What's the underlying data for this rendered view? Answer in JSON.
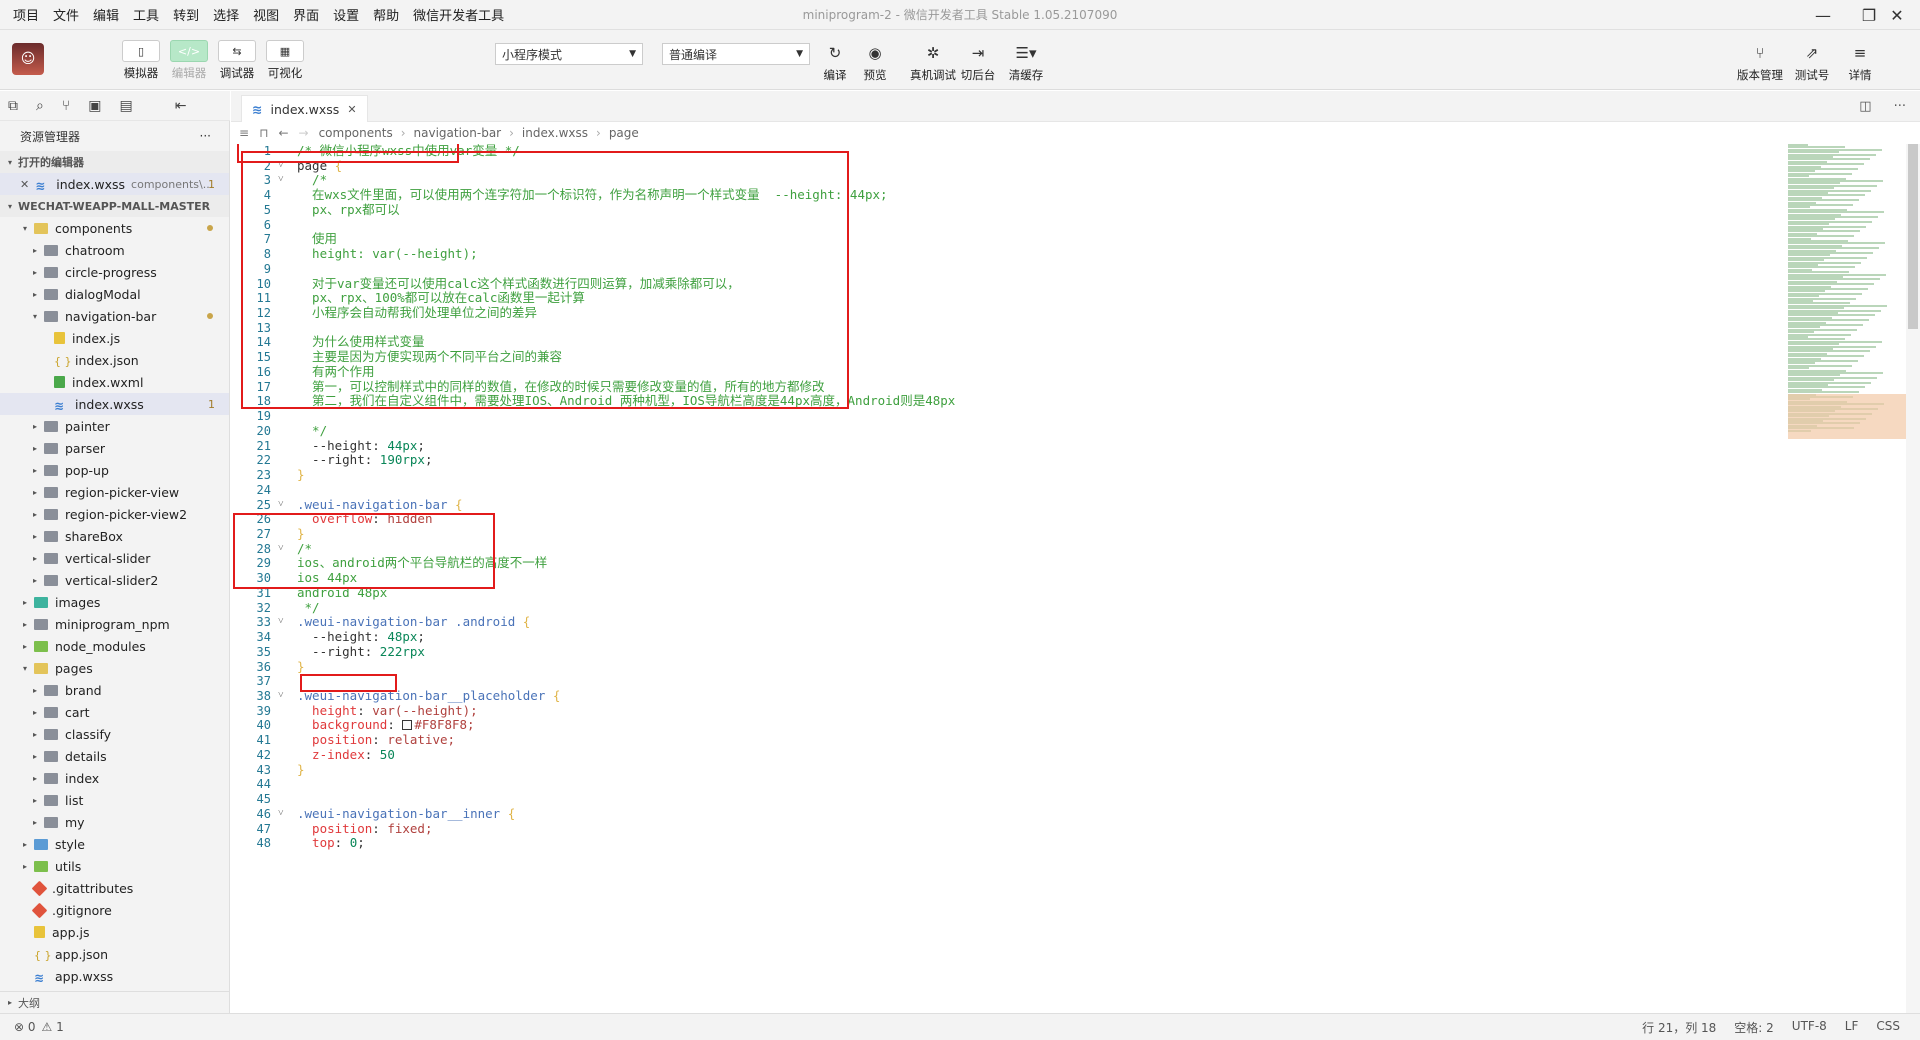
{
  "menubar": {
    "items": [
      "项目",
      "文件",
      "编辑",
      "工具",
      "转到",
      "选择",
      "视图",
      "界面",
      "设置",
      "帮助",
      "微信开发者工具"
    ],
    "title": "miniprogram-2 - 微信开发者工具 Stable 1.05.2107090"
  },
  "toolbar": {
    "simulator": "模拟器",
    "editor": "编辑器",
    "debugger": "调试器",
    "visual": "可视化",
    "mode_select": "小程序模式",
    "compile_select": "普通编译",
    "compile": "编译",
    "preview": "预览",
    "remote_debug": "真机调试",
    "background": "切后台",
    "clear_cache": "清缓存",
    "version_mgmt": "版本管理",
    "test_account": "测试号",
    "details": "详情"
  },
  "sidebar": {
    "title": "资源管理器",
    "more": "···",
    "open_editors_label": "打开的编辑器",
    "open_editor": {
      "name": "index.wxss",
      "desc": "components\\...",
      "badge": "1"
    },
    "project_label": "WECHAT-WEAPP-MALL-MASTER",
    "tree": [
      {
        "name": "components",
        "indent": 1,
        "twist": "▾",
        "type": "folder green",
        "dot": true
      },
      {
        "name": "chatroom",
        "indent": 2,
        "twist": "▸",
        "type": "folder"
      },
      {
        "name": "circle-progress",
        "indent": 2,
        "twist": "▸",
        "type": "folder"
      },
      {
        "name": "dialogModal",
        "indent": 2,
        "twist": "▸",
        "type": "folder"
      },
      {
        "name": "navigation-bar",
        "indent": 2,
        "twist": "▾",
        "type": "folder",
        "dot": true
      },
      {
        "name": "index.js",
        "indent": 3,
        "twist": "",
        "type": "fi-js"
      },
      {
        "name": "index.json",
        "indent": 3,
        "twist": "",
        "type": "fi-json"
      },
      {
        "name": "index.wxml",
        "indent": 3,
        "twist": "",
        "type": "fi-wxml"
      },
      {
        "name": "index.wxss",
        "indent": 3,
        "twist": "",
        "type": "fi-wxss",
        "badge": "1",
        "selected": true
      },
      {
        "name": "painter",
        "indent": 2,
        "twist": "▸",
        "type": "folder"
      },
      {
        "name": "parser",
        "indent": 2,
        "twist": "▸",
        "type": "folder"
      },
      {
        "name": "pop-up",
        "indent": 2,
        "twist": "▸",
        "type": "folder"
      },
      {
        "name": "region-picker-view",
        "indent": 2,
        "twist": "▸",
        "type": "folder"
      },
      {
        "name": "region-picker-view2",
        "indent": 2,
        "twist": "▸",
        "type": "folder"
      },
      {
        "name": "shareBox",
        "indent": 2,
        "twist": "▸",
        "type": "folder"
      },
      {
        "name": "vertical-slider",
        "indent": 2,
        "twist": "▸",
        "type": "folder"
      },
      {
        "name": "vertical-slider2",
        "indent": 2,
        "twist": "▸",
        "type": "folder"
      },
      {
        "name": "images",
        "indent": 1,
        "twist": "▸",
        "type": "folder teal"
      },
      {
        "name": "miniprogram_npm",
        "indent": 1,
        "twist": "▸",
        "type": "folder"
      },
      {
        "name": "node_modules",
        "indent": 1,
        "twist": "▸",
        "type": "folder lime"
      },
      {
        "name": "pages",
        "indent": 1,
        "twist": "▾",
        "type": "folder green"
      },
      {
        "name": "brand",
        "indent": 2,
        "twist": "▸",
        "type": "folder"
      },
      {
        "name": "cart",
        "indent": 2,
        "twist": "▸",
        "type": "folder"
      },
      {
        "name": "classify",
        "indent": 2,
        "twist": "▸",
        "type": "folder"
      },
      {
        "name": "details",
        "indent": 2,
        "twist": "▸",
        "type": "folder"
      },
      {
        "name": "index",
        "indent": 2,
        "twist": "▸",
        "type": "folder"
      },
      {
        "name": "list",
        "indent": 2,
        "twist": "▸",
        "type": "folder"
      },
      {
        "name": "my",
        "indent": 2,
        "twist": "▸",
        "type": "folder"
      },
      {
        "name": "style",
        "indent": 1,
        "twist": "▸",
        "type": "folder blue"
      },
      {
        "name": "utils",
        "indent": 1,
        "twist": "▸",
        "type": "folder lime"
      },
      {
        "name": ".gitattributes",
        "indent": 1,
        "twist": "",
        "type": "fi-git"
      },
      {
        "name": ".gitignore",
        "indent": 1,
        "twist": "",
        "type": "fi-git"
      },
      {
        "name": "app.js",
        "indent": 1,
        "twist": "",
        "type": "fi-js"
      },
      {
        "name": "app.json",
        "indent": 1,
        "twist": "",
        "type": "fi-json"
      },
      {
        "name": "app.wxss",
        "indent": 1,
        "twist": "",
        "type": "fi-wxss"
      }
    ],
    "outline_label": "大纲"
  },
  "editor": {
    "tab_label": "index.wxss",
    "breadcrumb": [
      "components",
      "navigation-bar",
      "index.wxss",
      "page"
    ],
    "lines": [
      {
        "n": 1,
        "fold": "",
        "parts": [
          [
            "c-com",
            "/* 微信小程序wxss中使用var变量 */"
          ]
        ]
      },
      {
        "n": 2,
        "fold": "˅",
        "parts": [
          [
            "c-plain",
            "page "
          ],
          [
            "c-brace",
            "{"
          ]
        ]
      },
      {
        "n": 3,
        "fold": "˅",
        "parts": [
          [
            "c-com",
            "  /*"
          ]
        ]
      },
      {
        "n": 4,
        "fold": "",
        "parts": [
          [
            "c-com",
            "  在wxs文件里面，可以使用两个连字符加一个标识符，作为名称声明一个样式变量  --height: 44px;"
          ]
        ]
      },
      {
        "n": 5,
        "fold": "",
        "parts": [
          [
            "c-com",
            "  px、rpx都可以"
          ]
        ]
      },
      {
        "n": 6,
        "fold": "",
        "parts": [
          [
            "c-com",
            ""
          ]
        ]
      },
      {
        "n": 7,
        "fold": "",
        "parts": [
          [
            "c-com",
            "  使用"
          ]
        ]
      },
      {
        "n": 8,
        "fold": "",
        "parts": [
          [
            "c-com",
            "  height: var(--height);"
          ]
        ]
      },
      {
        "n": 9,
        "fold": "",
        "parts": [
          [
            "c-com",
            ""
          ]
        ]
      },
      {
        "n": 10,
        "fold": "",
        "parts": [
          [
            "c-com",
            "  对于var变量还可以使用calc这个样式函数进行四则运算，加减乘除都可以，"
          ]
        ]
      },
      {
        "n": 11,
        "fold": "",
        "parts": [
          [
            "c-com",
            "  px、rpx、100%都可以放在calc函数里一起计算"
          ]
        ]
      },
      {
        "n": 12,
        "fold": "",
        "parts": [
          [
            "c-com",
            "  小程序会自动帮我们处理单位之间的差异"
          ]
        ]
      },
      {
        "n": 13,
        "fold": "",
        "parts": [
          [
            "c-com",
            ""
          ]
        ]
      },
      {
        "n": 14,
        "fold": "",
        "parts": [
          [
            "c-com",
            "  为什么使用样式变量"
          ]
        ]
      },
      {
        "n": 15,
        "fold": "",
        "parts": [
          [
            "c-com",
            "  主要是因为方便实现两个不同平台之间的兼容"
          ]
        ]
      },
      {
        "n": 16,
        "fold": "",
        "parts": [
          [
            "c-com",
            "  有两个作用"
          ]
        ]
      },
      {
        "n": 17,
        "fold": "",
        "parts": [
          [
            "c-com",
            "  第一，可以控制样式中的同样的数值，在修改的时候只需要修改变量的值，所有的地方都修改"
          ]
        ]
      },
      {
        "n": 18,
        "fold": "",
        "parts": [
          [
            "c-com",
            "  第二，我们在自定义组件中，需要处理IOS、Android 两种机型，IOS导航栏高度是44px高度，Android则是48px"
          ]
        ]
      },
      {
        "n": 19,
        "fold": "",
        "parts": [
          [
            "c-com",
            ""
          ]
        ]
      },
      {
        "n": 20,
        "fold": "",
        "parts": [
          [
            "c-com",
            "  */"
          ]
        ]
      },
      {
        "n": 21,
        "fold": "",
        "parts": [
          [
            "c-plain",
            "  --height: "
          ],
          [
            "c-num",
            "44px"
          ],
          [
            "c-plain",
            ";"
          ]
        ]
      },
      {
        "n": 22,
        "fold": "",
        "parts": [
          [
            "c-plain",
            "  --right: "
          ],
          [
            "c-num",
            "190rpx"
          ],
          [
            "c-plain",
            ";"
          ]
        ]
      },
      {
        "n": 23,
        "fold": "",
        "parts": [
          [
            "c-brace",
            "}"
          ]
        ]
      },
      {
        "n": 24,
        "fold": "",
        "parts": [
          [
            "c-plain",
            ""
          ]
        ]
      },
      {
        "n": 25,
        "fold": "˅",
        "parts": [
          [
            "c-sel",
            ".weui-navigation-bar "
          ],
          [
            "c-brace",
            "{"
          ]
        ]
      },
      {
        "n": 26,
        "fold": "",
        "parts": [
          [
            "c-prop",
            "  overflow"
          ],
          [
            "c-plain",
            ": "
          ],
          [
            "c-val",
            "hidden"
          ]
        ]
      },
      {
        "n": 27,
        "fold": "",
        "parts": [
          [
            "c-brace",
            "}"
          ]
        ]
      },
      {
        "n": 28,
        "fold": "˅",
        "parts": [
          [
            "c-com",
            "/*"
          ]
        ]
      },
      {
        "n": 29,
        "fold": "",
        "parts": [
          [
            "c-com",
            "ios、android两个平台导航栏的高度不一样"
          ]
        ]
      },
      {
        "n": 30,
        "fold": "",
        "parts": [
          [
            "c-com",
            "ios 44px"
          ]
        ]
      },
      {
        "n": 31,
        "fold": "",
        "parts": [
          [
            "c-com",
            "android 48px"
          ]
        ]
      },
      {
        "n": 32,
        "fold": "",
        "parts": [
          [
            "c-com",
            " */"
          ]
        ]
      },
      {
        "n": 33,
        "fold": "˅",
        "parts": [
          [
            "c-sel",
            ".weui-navigation-bar .android "
          ],
          [
            "c-brace",
            "{"
          ]
        ]
      },
      {
        "n": 34,
        "fold": "",
        "parts": [
          [
            "c-plain",
            "  --height: "
          ],
          [
            "c-num",
            "48px"
          ],
          [
            "c-plain",
            ";"
          ]
        ]
      },
      {
        "n": 35,
        "fold": "",
        "parts": [
          [
            "c-plain",
            "  --right: "
          ],
          [
            "c-num",
            "222rpx"
          ]
        ]
      },
      {
        "n": 36,
        "fold": "",
        "parts": [
          [
            "c-brace",
            "}"
          ]
        ]
      },
      {
        "n": 37,
        "fold": "",
        "parts": [
          [
            "c-plain",
            ""
          ]
        ]
      },
      {
        "n": 38,
        "fold": "˅",
        "parts": [
          [
            "c-sel",
            ".weui-navigation-bar__placeholder "
          ],
          [
            "c-brace",
            "{"
          ]
        ]
      },
      {
        "n": 39,
        "fold": "",
        "parts": [
          [
            "c-prop",
            "  height"
          ],
          [
            "c-plain",
            ": "
          ],
          [
            "c-val",
            "var(--height);"
          ]
        ]
      },
      {
        "n": 40,
        "fold": "",
        "parts": [
          [
            "c-prop",
            "  background"
          ],
          [
            "c-plain",
            ": "
          ],
          [
            "swatch",
            ""
          ],
          [
            "c-val",
            "#F8F8F8;"
          ]
        ]
      },
      {
        "n": 41,
        "fold": "",
        "parts": [
          [
            "c-prop",
            "  position"
          ],
          [
            "c-plain",
            ": "
          ],
          [
            "c-val",
            "relative;"
          ]
        ]
      },
      {
        "n": 42,
        "fold": "",
        "parts": [
          [
            "c-prop",
            "  z-index"
          ],
          [
            "c-plain",
            ": "
          ],
          [
            "c-num",
            "50"
          ]
        ]
      },
      {
        "n": 43,
        "fold": "",
        "parts": [
          [
            "c-brace",
            "}"
          ]
        ]
      },
      {
        "n": 44,
        "fold": "",
        "parts": [
          [
            "c-plain",
            ""
          ]
        ]
      },
      {
        "n": 45,
        "fold": "",
        "parts": [
          [
            "c-plain",
            ""
          ]
        ]
      },
      {
        "n": 46,
        "fold": "˅",
        "parts": [
          [
            "c-sel",
            ".weui-navigation-bar__inner "
          ],
          [
            "c-brace",
            "{"
          ]
        ]
      },
      {
        "n": 47,
        "fold": "",
        "parts": [
          [
            "c-prop",
            "  position"
          ],
          [
            "c-plain",
            ": "
          ],
          [
            "c-val",
            "fixed;"
          ]
        ]
      },
      {
        "n": 48,
        "fold": "",
        "parts": [
          [
            "c-prop",
            "  top"
          ],
          [
            "c-plain",
            ": "
          ],
          [
            "c-num",
            "0"
          ],
          [
            "c-plain",
            ";"
          ]
        ]
      }
    ]
  },
  "statusbar": {
    "errors": "⊗ 0",
    "warnings": "⚠ 1",
    "position": "行 21，列 18",
    "spaces": "空格: 2",
    "encoding": "UTF-8",
    "eol": "LF",
    "language": "CSS"
  }
}
